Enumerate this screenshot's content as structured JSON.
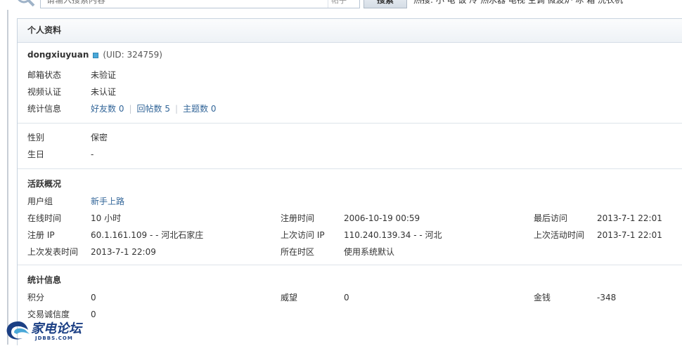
{
  "search": {
    "placeholder": "请输入搜索内容",
    "scope": "帖子",
    "button_label": "搜索",
    "hot_words": "热搜: 小 电 饭 冷 热水器 电视 空调 微波炉 冰 箱 洗衣机"
  },
  "panel": {
    "title": "个人资料",
    "profile": {
      "username": "dongxiuyuan",
      "uid": "(UID: 324759)",
      "rows": [
        {
          "label": "邮箱状态",
          "value": "未验证"
        },
        {
          "label": "视频认证",
          "value": "未认证"
        }
      ],
      "stats_label": "统计信息",
      "stats": [
        {
          "label": "好友数",
          "value": "0"
        },
        {
          "label": "回帖数",
          "value": "5"
        },
        {
          "label": "主题数",
          "value": "0"
        }
      ]
    },
    "personal": [
      {
        "label": "性别",
        "value": "保密"
      },
      {
        "label": "生日",
        "value": "-"
      }
    ],
    "activity": {
      "title": "活跃概况",
      "usergroup_label": "用户组",
      "usergroup_value": "新手上路",
      "online_label": "在线时间",
      "online_value": "10 小时",
      "regtime_label": "注册时间",
      "regtime_value": "2006-10-19 00:59",
      "lastvisit_label": "最后访问",
      "lastvisit_value": "2013-7-1 22:01",
      "regip_label": "注册 IP",
      "regip_value": "60.1.161.109 - - 河北石家庄",
      "lastip_label": "上次访问 IP",
      "lastip_value": "110.240.139.34 - - 河北",
      "lastactive_label": "上次活动时间",
      "lastactive_value": "2013-7-1 22:01",
      "lastpost_label": "上次发表时间",
      "lastpost_value": "2013-7-1 22:09",
      "timezone_label": "所在时区",
      "timezone_value": "使用系统默认"
    },
    "statistics": {
      "title": "统计信息",
      "points_label": "积分",
      "points_value": "0",
      "prestige_label": "威望",
      "prestige_value": "0",
      "money_label": "金钱",
      "money_value": "-348",
      "credit_label": "交易诚信度",
      "credit_value": "0"
    }
  },
  "watermark": {
    "text": "家电论坛",
    "sub": "JDBBS.COM"
  },
  "colors": {
    "link": "#336699",
    "online_badge": "#4aa8d8",
    "logo": "#1b3f84"
  }
}
